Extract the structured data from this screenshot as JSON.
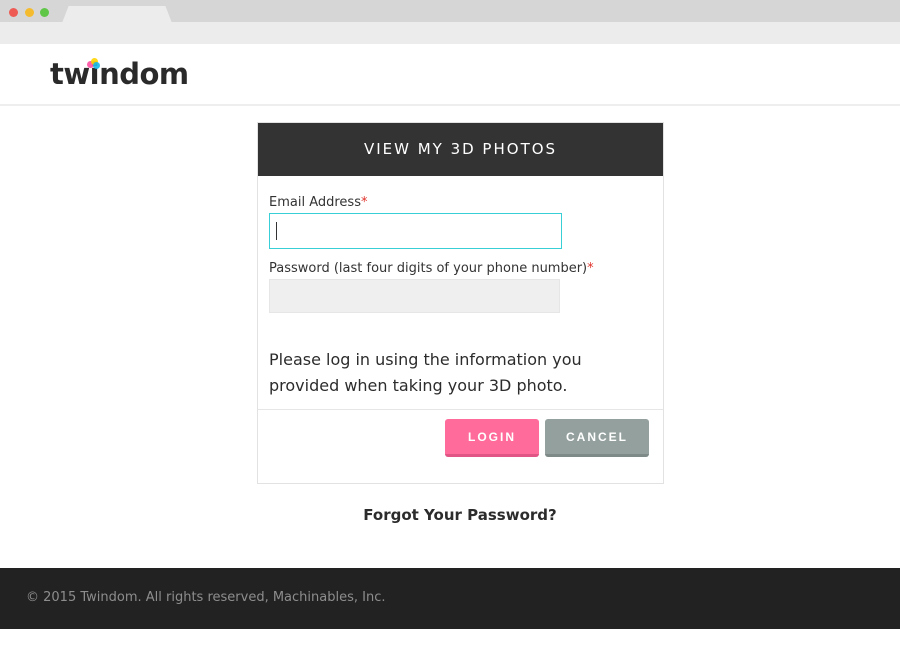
{
  "brand": {
    "name": "twindom",
    "dot_colors": [
      "#ff4fa3",
      "#ffd400",
      "#18b7e8"
    ]
  },
  "login_card": {
    "title": "VIEW MY 3D PHOTOS",
    "email": {
      "label": "Email Address",
      "required_mark": "*",
      "value": ""
    },
    "password": {
      "label": "Password (last four digits of your phone number)",
      "required_mark": "*",
      "value": ""
    },
    "info": "Please log in using the information you provided when taking your 3D photo.",
    "login_label": "LOGIN",
    "cancel_label": "CANCEL"
  },
  "forgot_password": "Forgot Your Password?",
  "footer": {
    "copyright": "© 2015 Twindom. All rights reserved, Machinables, Inc."
  },
  "colors": {
    "header_bg": "#333333",
    "login_button": "#ff6b9a",
    "cancel_button": "#93a09d",
    "focus_border": "#38cfd6",
    "required": "#e0322b",
    "footer_bg": "#222222"
  },
  "icons": {
    "close": "red-circle",
    "minimize": "yellow-circle",
    "maximize": "green-circle"
  }
}
